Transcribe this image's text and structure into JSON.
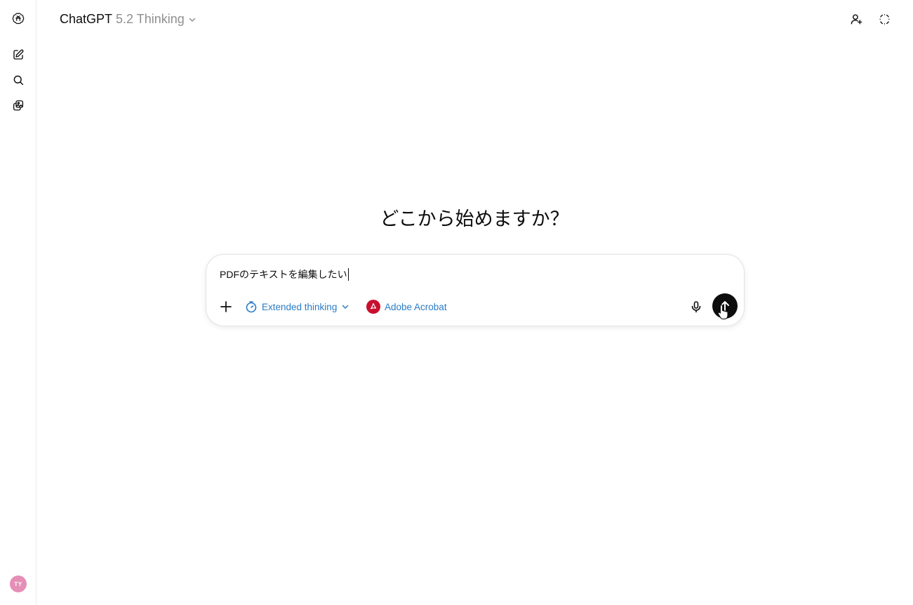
{
  "header": {
    "model_name": "ChatGPT",
    "model_variant": "5.2 Thinking",
    "icons": {
      "add_people": "add-person-icon",
      "temporary_chat": "temporary-chat-icon"
    }
  },
  "sidebar": {
    "icons": [
      "openai-logo-icon",
      "new-chat-icon",
      "search-icon",
      "library-icon"
    ],
    "avatar_initials": "TY"
  },
  "main": {
    "headline": "どこから始めますか？"
  },
  "composer": {
    "input_text": "PDFのテキストを編集したい",
    "tools": {
      "thinking_label": "Extended thinking",
      "app_label": "Adobe Acrobat"
    }
  },
  "colors": {
    "accent_blue": "#2a7bc5",
    "acrobat_red": "#c8102e",
    "avatar_pink": "#e58fb6",
    "send_button": "#0d0d0d"
  }
}
